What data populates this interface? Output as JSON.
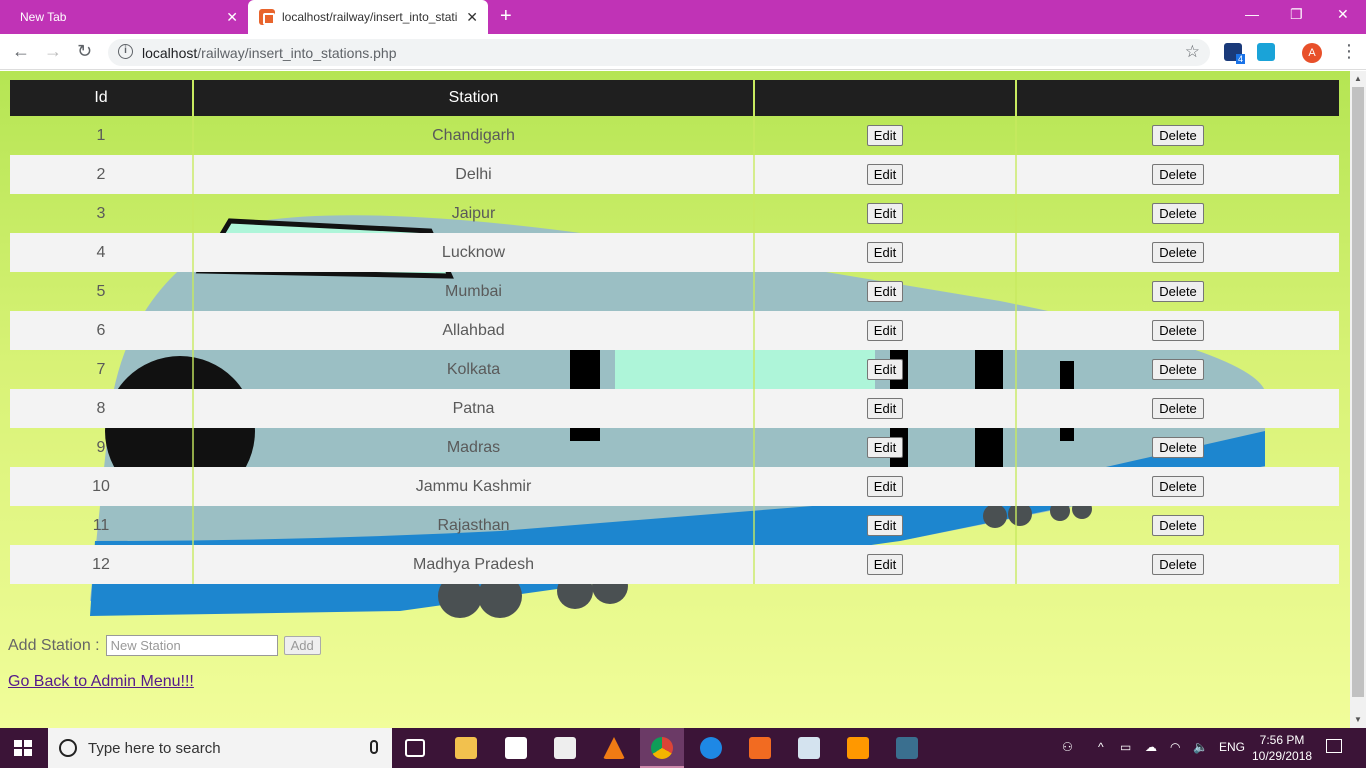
{
  "browser": {
    "tabs": [
      {
        "label": "New Tab"
      },
      {
        "label": "localhost/railway/insert_into_stati"
      }
    ],
    "url_host": "localhost",
    "url_path": "/railway/insert_into_stations.php",
    "profile_initial": "A",
    "extension_badge": "4"
  },
  "table": {
    "headers": [
      "Id",
      "Station",
      "",
      ""
    ],
    "edit_label": "Edit",
    "delete_label": "Delete",
    "rows": [
      {
        "id": "1",
        "station": "Chandigarh"
      },
      {
        "id": "2",
        "station": "Delhi"
      },
      {
        "id": "3",
        "station": "Jaipur"
      },
      {
        "id": "4",
        "station": "Lucknow"
      },
      {
        "id": "5",
        "station": "Mumbai"
      },
      {
        "id": "6",
        "station": "Allahbad"
      },
      {
        "id": "7",
        "station": "Kolkata"
      },
      {
        "id": "8",
        "station": "Patna"
      },
      {
        "id": "9",
        "station": "Madras"
      },
      {
        "id": "10",
        "station": "Jammu Kashmir"
      },
      {
        "id": "11",
        "station": "Rajasthan"
      },
      {
        "id": "12",
        "station": "Madhya Pradesh"
      }
    ]
  },
  "form": {
    "label": "Add Station :",
    "placeholder": "New Station",
    "button": "Add"
  },
  "back_link": "Go Back to Admin Menu!!!",
  "taskbar": {
    "search_placeholder": "Type here to search",
    "language": "ENG",
    "time": "7:56 PM",
    "date": "10/29/2018"
  },
  "colors": {
    "tabstrip": "#c033b6",
    "taskbar": "#3b1437",
    "page_gradient_top": "#b5e553",
    "page_gradient_bottom": "#f1fd9a",
    "header_bg": "#1f1f1f"
  }
}
